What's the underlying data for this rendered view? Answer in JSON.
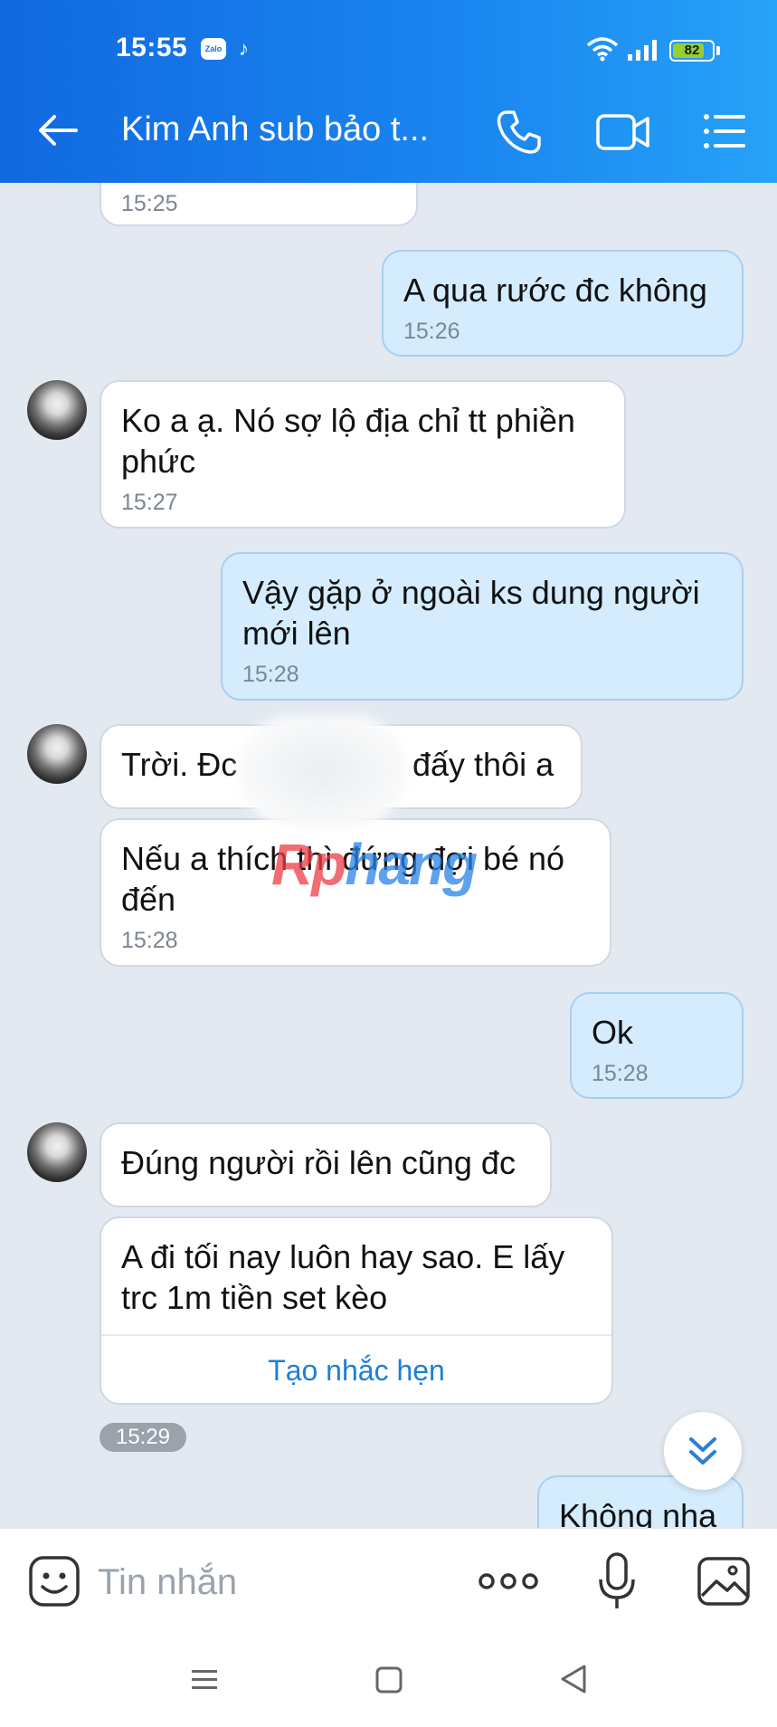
{
  "status_bar": {
    "time": "15:55",
    "zalo_badge": "Zalo",
    "battery_level": "82",
    "battery_fraction": 0.82
  },
  "header": {
    "title": "Kim Anh sub bảo t...",
    "color": "#1a86f0"
  },
  "messages": [
    {
      "side": "recv",
      "text": "",
      "time": "15:25"
    },
    {
      "side": "sent",
      "text": "A qua rước đc không",
      "time": "15:26"
    },
    {
      "side": "recv",
      "text": "Ko a ạ. Nó sợ lộ địa chỉ tt phiền phức",
      "time": "15:27"
    },
    {
      "side": "sent",
      "text": "Vậy gặp ở ngoài ks dung người mới lên",
      "time": "15:28"
    },
    {
      "side": "recv",
      "text_start": "Trời. Đc",
      "text_end": "đấy thôi a"
    },
    {
      "side": "recv",
      "text": "Nếu a thích thì đứng đợi bé nó đến",
      "time": "15:28"
    },
    {
      "side": "sent",
      "text": "Ok",
      "time": "15:28"
    },
    {
      "side": "recv",
      "text": "Đúng người rồi lên cũng đc"
    },
    {
      "side": "recv",
      "text": "A đi tối nay luôn hay sao. E lấy trc 1m tiền set kèo",
      "action": "Tạo nhắc hẹn"
    },
    {
      "side": "sent",
      "text": "Không nha"
    }
  ],
  "time_pill": "15:29",
  "watermark": {
    "part1": "Rp",
    "part2": "hang"
  },
  "input": {
    "placeholder": "Tin nhắn"
  },
  "colors": {
    "sent_bubble": "#d4ecfd",
    "received_bubble": "#ffffff",
    "background": "#e2e9f1",
    "link": "#1b7fd8"
  }
}
